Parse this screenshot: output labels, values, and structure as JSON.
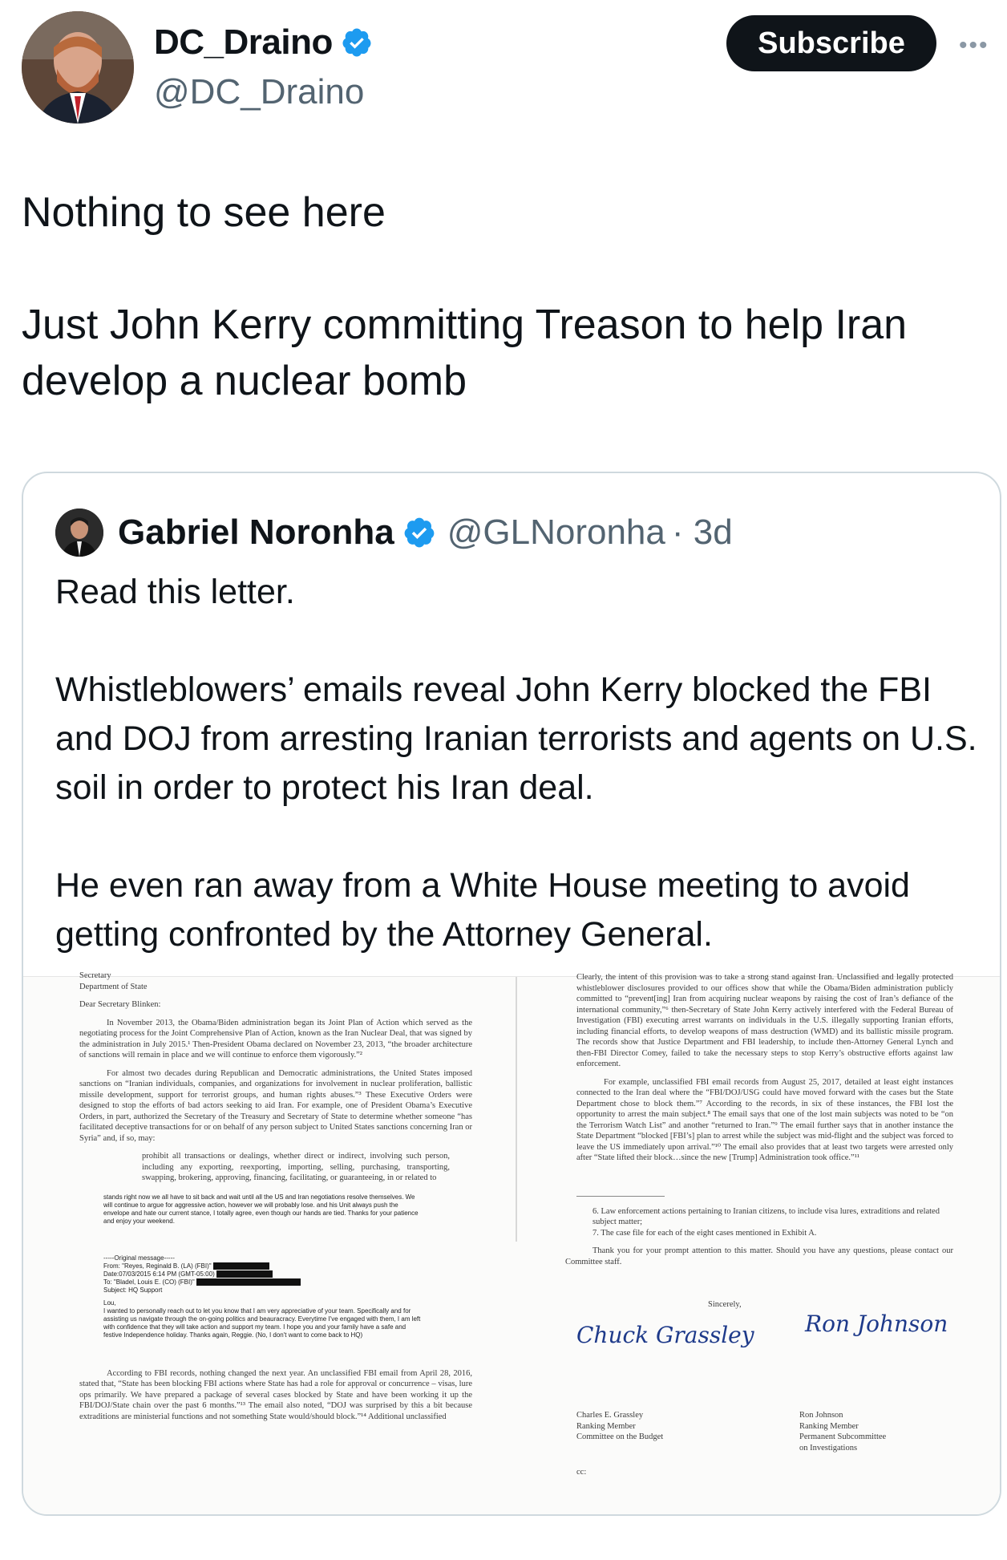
{
  "author": {
    "display_name": "DC_Draino",
    "handle": "@DC_Draino",
    "subscribe_label": "Subscribe",
    "more_icon": "more-horizontal-icon"
  },
  "tweet": {
    "line1": "Nothing to see here",
    "line2": "Just John Kerry committing Treason to help Iran develop a nuclear bomb"
  },
  "quoted": {
    "display_name": "Gabriel Noronha",
    "handle": "@GLNoronha",
    "time": "· 3d",
    "text1": "Read this letter.",
    "text2": "Whistleblowers’ emails reveal John Kerry blocked the FBI and DOJ from arresting Iranian terrorists and agents on U.S. soil in order to protect his Iran deal.",
    "text3": "He even ran away from a White House meeting to avoid getting confronted by the Attorney General."
  },
  "letter": {
    "left": {
      "top_cut": "Secretary",
      "dept": "Department of State",
      "salutation": "Dear Secretary Blinken:",
      "p1": "In November 2013, the Obama/Biden administration began its Joint Plan of Action which served as the negotiating process for the Joint Comprehensive Plan of Action, known as the Iran Nuclear Deal, that was signed by the administration in July 2015.¹ Then-President Obama declared on November 23, 2013, “the broader architecture of sanctions will remain in place and we will continue to enforce them vigorously.”²",
      "p2": "For almost two decades during Republican and Democratic administrations, the United States imposed sanctions on “Iranian individuals, companies, and organizations for involvement in nuclear proliferation, ballistic missile development, support for terrorist groups, and human rights abuses.”³ These Executive Orders were designed to stop the efforts of bad actors seeking to aid Iran. For example, one of President Obama’s Executive Orders, in part, authorized the Secretary of the Treasury and Secretary of State to determine whether someone “has facilitated deceptive transactions for or on behalf of any person subject to United States sanctions concerning Iran or Syria” and, if so, may:",
      "quote": "prohibit all transactions or dealings, whether direct or indirect, involving such person, including any exporting, reexporting, importing, selling, purchasing, transporting, swapping, brokering, approving, financing, facilitating, or guaranteeing, in or related to",
      "email1": "stands right now we all have to sit back and wait until all the US and Iran negotiations resolve themselves. We will continue to argue for aggressive action, however we will probably lose. and his Unit always push the envelope and hate our current stance, I totally agree, even though our hands are tied. Thanks for your patience and enjoy your weekend.",
      "orig_msg": "-----Original message-----",
      "from": "From: \"Reyes, Reginald B. (LA) (FBI)\"",
      "date": "Date:07/03/2015 6:14 PM (GMT-05:00)",
      "to": "To: \"Bladel, Louis E. (CO) (FBI)\"",
      "subject": "Subject: HQ Support",
      "greet": "Lou,",
      "email2": "I wanted to personally reach out to let you know that I am very appreciative of your team. Specifically and for assisting us navigate through the on-going politics and beauracracy. Everytime I've engaged with them, I am left with confidence that they will take action and support my team. I hope you and your family have a safe and festive Independence holiday. Thanks again, Reggie. (No, I don't want to come back to HQ)",
      "p3": "According to FBI records, nothing changed the next year. An unclassified FBI email from April 28, 2016, stated that, “State has been blocking FBI actions where State has had a role for approval or concurrence – visas, lure ops primarily. We have prepared a package of several cases blocked by State and have been working it up the FBI/DOJ/State chain over the past 6 months.”¹³ The email also noted, “DOJ was surprised by this a bit because extraditions are ministerial functions and not something State would/should block.”¹⁴ Additional unclassified"
    },
    "right": {
      "p1": "Clearly, the intent of this provision was to take a strong stand against Iran. Unclassified and legally protected whistleblower disclosures provided to our offices show that while the Obama/Biden administration publicly committed to “prevent[ing] Iran from acquiring nuclear weapons by raising the cost of Iran’s defiance of the international community,”⁶ then-Secretary of State John Kerry actively interfered with the Federal Bureau of Investigation (FBI) executing arrest warrants on individuals in the U.S. illegally supporting Iranian efforts, including financial efforts, to develop weapons of mass destruction (WMD) and its ballistic missile program. The records show that Justice Department and FBI leadership, to include then-Attorney General Lynch and then-FBI Director Comey, failed to take the necessary steps to stop Kerry’s obstructive efforts against law enforcement.",
      "p2": "For example, unclassified FBI email records from August 25, 2017, detailed at least eight instances connected to the Iran deal where the “FBI/DOJ/USG could have moved forward with the cases but the State Department chose to block them.”⁷ According to the records, in six of these instances, the FBI lost the opportunity to arrest the main subject.⁸ The email says that one of the lost main subjects was noted to be “on the Terrorism Watch List” and another “returned to Iran.”⁹ The email further says that in another instance the State Department “blocked [FBI’s] plan to arrest while the subject was mid-flight and the subject was forced to leave the US immediately upon arrival.”¹⁰ The email also provides that at least two targets were arrested only after “State lifted their block…since the new [Trump] Administration took office.”¹¹",
      "item6": "6. Law enforcement actions pertaining to Iranian citizens, to include visa lures, extraditions and related subject matter;",
      "item7": "7. The case file for each of the eight cases mentioned in Exhibit A.",
      "thanks": "Thank you for your prompt attention to this matter. Should you have any questions, please contact our Committee staff.",
      "sincerely": "Sincerely,",
      "sig1": "Chuck Grassley",
      "sig2": "Ron Johnson",
      "name1": "Charles E. Grassley",
      "role1a": "Ranking Member",
      "role1b": "Committee on the Budget",
      "name2": "Ron Johnson",
      "role2a": "Ranking Member",
      "role2b": "Permanent Subcommittee",
      "role2c": "on Investigations",
      "cc": "cc:"
    }
  },
  "colors": {
    "verified": "#1d9bf0",
    "text": "#0f1419",
    "muted": "#536471",
    "border": "#cfd9de"
  }
}
